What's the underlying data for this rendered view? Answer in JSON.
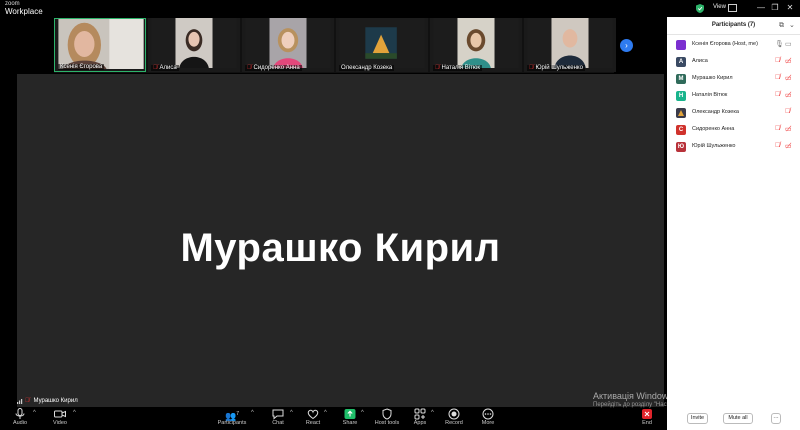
{
  "app": {
    "brand_top": "zoom",
    "brand_bottom": "Workplace",
    "view_label": "View"
  },
  "video_strip": {
    "tiles": [
      {
        "name": "Ксенія Єгорова",
        "muted": false,
        "active": true
      },
      {
        "name": "Алиса",
        "muted": true,
        "active": false
      },
      {
        "name": "Сидоренко Анна",
        "muted": true,
        "active": false
      },
      {
        "name": "Олександр Козека",
        "muted": false,
        "active": false
      },
      {
        "name": "Наталія Вітюк",
        "muted": true,
        "active": false
      },
      {
        "name": "Юрій Шульженко",
        "muted": true,
        "active": false
      }
    ]
  },
  "stage": {
    "speaker": "Мурашко Кирил",
    "bottom_label": "Мурашко Кирил"
  },
  "toolbar": {
    "audio": "Audio",
    "video": "Video",
    "participants": "Participants",
    "participants_count": "7",
    "chat": "Chat",
    "react": "React",
    "share": "Share",
    "host_tools": "Host tools",
    "apps": "Apps",
    "record": "Record",
    "more": "More",
    "end": "End"
  },
  "participants_panel": {
    "title": "Participants (7)",
    "invite": "Invite",
    "mute_all": "Mute all",
    "more": "···",
    "items": [
      {
        "initial": "",
        "name": "Ксенія Єгорова (Host, me)",
        "color": "#7b2fd0",
        "mic_muted": false,
        "video_off": false
      },
      {
        "initial": "А",
        "name": "Алиса",
        "color": "#3a4a63",
        "mic_muted": true,
        "video_off": true
      },
      {
        "initial": "М",
        "name": "Мурашко Кирил",
        "color": "#2f6a5a",
        "mic_muted": true,
        "video_off": true
      },
      {
        "initial": "Н",
        "name": "Наталія Вітюк",
        "color": "#19b48c",
        "mic_muted": true,
        "video_off": true
      },
      {
        "initial": "",
        "name": "Олександр Козека",
        "color": "#3b3b4a",
        "mic_muted": true,
        "video_off": false
      },
      {
        "initial": "С",
        "name": "Сидоренко Анна",
        "color": "#d0322c",
        "mic_muted": true,
        "video_off": true
      },
      {
        "initial": "Ю",
        "name": "Юрій Шульженко",
        "color": "#b8323a",
        "mic_muted": true,
        "video_off": true
      }
    ]
  },
  "watermark": {
    "line1": "Активація Windows",
    "line2": "Перейдіть до розділу \"Настройки\", щоб активувати Windows."
  }
}
